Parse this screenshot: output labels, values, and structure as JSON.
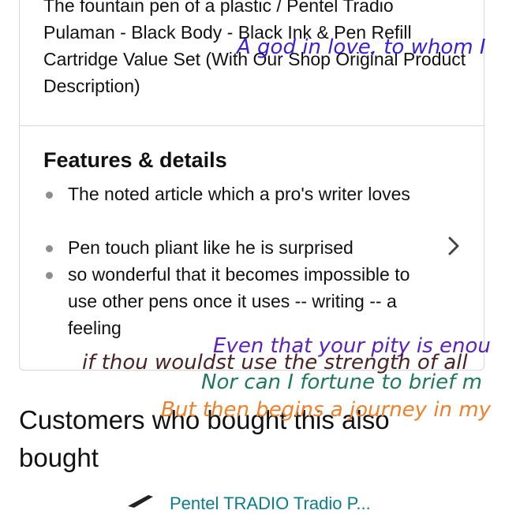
{
  "product": {
    "title": "The fountain pen of a plastic / Pentel Tradio Pulaman - Black Body - Black Ink & Pen Refill Cartridge Value Set (With Our Shop Original Product Description)"
  },
  "features": {
    "heading": "Features & details",
    "items": [
      "The noted article which a pro's writer loves",
      "Pen touch pliant like he is surprised",
      "so wonderful that it becomes impossible to use other pens once it uses -- writing -- a feeling"
    ]
  },
  "customers": {
    "heading": "Customers who bought this also bought",
    "first_item_partial": "Pentel TRADIO Tradio P..."
  },
  "overlays": {
    "colors": [
      "#3a1fd6",
      "#5b22c0",
      "#4a2222",
      "#1f7a5c",
      "#f07f2a"
    ],
    "line1": "A god in love, to whom I",
    "line2": "Even that your pity is enou",
    "line3": "if thou wouldst use the strength of all",
    "line4": "Nor can I fortune to brief m",
    "line5": "But then begins a journey in my"
  }
}
